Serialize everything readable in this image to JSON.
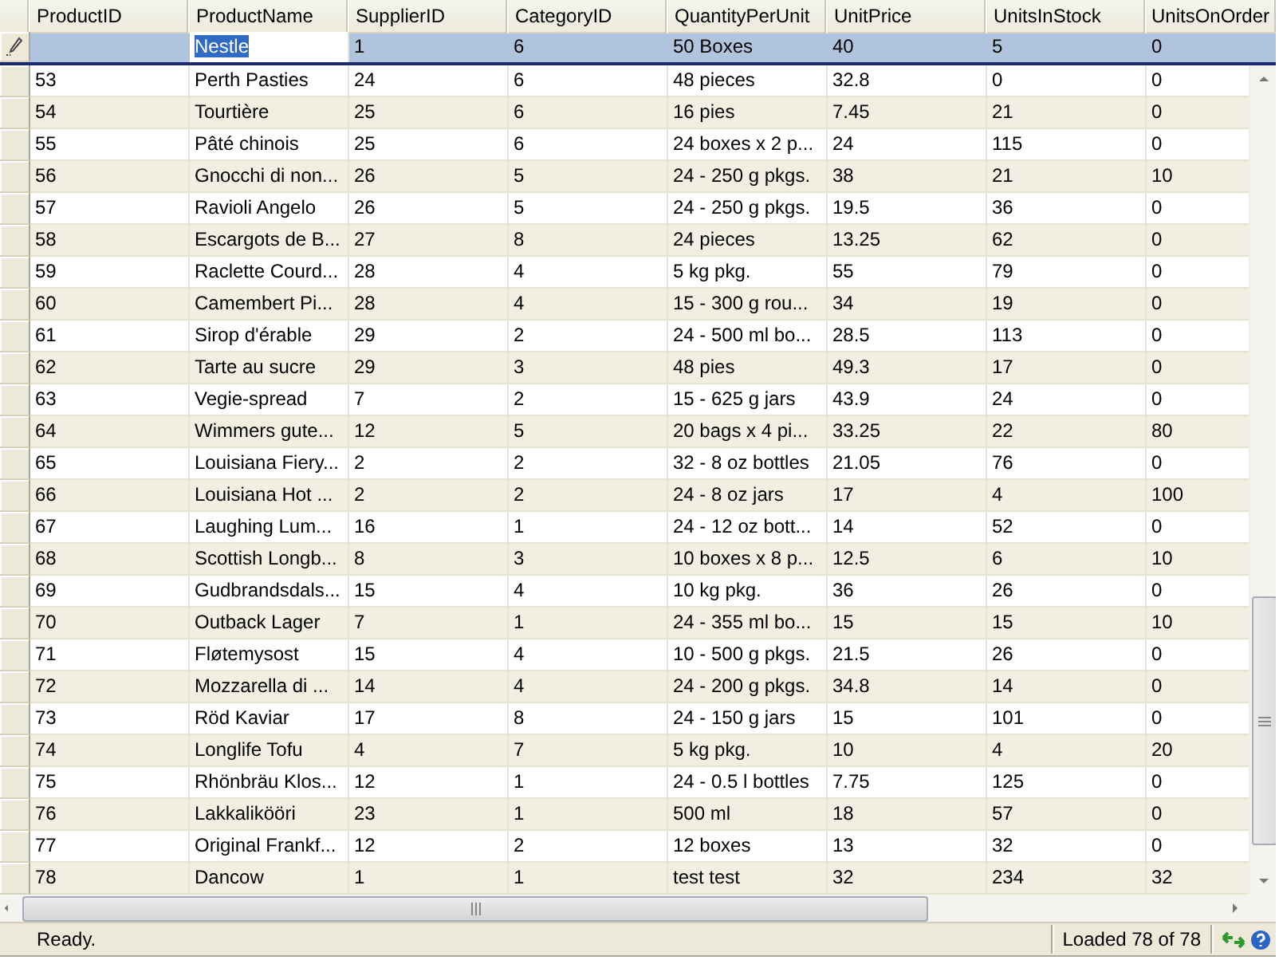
{
  "columns": [
    {
      "label": "ProductID"
    },
    {
      "label": "ProductName"
    },
    {
      "label": "SupplierID"
    },
    {
      "label": "CategoryID"
    },
    {
      "label": "QuantityPerUnit"
    },
    {
      "label": "UnitPrice"
    },
    {
      "label": "UnitsInStock"
    },
    {
      "label": "UnitsOnOrder"
    }
  ],
  "new_row": {
    "editing": true,
    "cells": [
      {
        "text": "Nestle",
        "editing": true
      },
      {
        "text": "1",
        "editing": false
      },
      {
        "text": "6",
        "editing": false
      },
      {
        "text": "50 Boxes",
        "editing": false
      },
      {
        "text": "40",
        "editing": false
      },
      {
        "text": "5",
        "editing": false
      },
      {
        "text": "0",
        "editing": false
      }
    ]
  },
  "rows": [
    {
      "selected": false,
      "cells": [
        "53",
        "Perth Pasties",
        "24",
        "6",
        "48 pieces",
        "32.8",
        "0",
        "0"
      ]
    },
    {
      "selected": false,
      "cells": [
        "54",
        "Tourtière",
        "25",
        "6",
        "16 pies",
        "7.45",
        "21",
        "0"
      ]
    },
    {
      "selected": false,
      "cells": [
        "55",
        "Pâté chinois",
        "25",
        "6",
        "24 boxes x 2 p...",
        "24",
        "115",
        "0"
      ]
    },
    {
      "selected": false,
      "cells": [
        "56",
        "Gnocchi di non...",
        "26",
        "5",
        "24 - 250 g pkgs.",
        "38",
        "21",
        "10"
      ]
    },
    {
      "selected": false,
      "cells": [
        "57",
        "Ravioli Angelo",
        "26",
        "5",
        "24 - 250 g pkgs.",
        "19.5",
        "36",
        "0"
      ]
    },
    {
      "selected": false,
      "cells": [
        "58",
        "Escargots de B...",
        "27",
        "8",
        "24 pieces",
        "13.25",
        "62",
        "0"
      ]
    },
    {
      "selected": false,
      "cells": [
        "59",
        "Raclette Courd...",
        "28",
        "4",
        "5 kg pkg.",
        "55",
        "79",
        "0"
      ]
    },
    {
      "selected": false,
      "cells": [
        "60",
        "Camembert Pi...",
        "28",
        "4",
        "15 - 300 g rou...",
        "34",
        "19",
        "0"
      ]
    },
    {
      "selected": false,
      "cells": [
        "61",
        "Sirop d'érable",
        "29",
        "2",
        "24 - 500 ml bo...",
        "28.5",
        "113",
        "0"
      ]
    },
    {
      "selected": false,
      "cells": [
        "62",
        "Tarte au sucre",
        "29",
        "3",
        "48 pies",
        "49.3",
        "17",
        "0"
      ]
    },
    {
      "selected": false,
      "cells": [
        "63",
        "Vegie-spread",
        "7",
        "2",
        "15 - 625 g jars",
        "43.9",
        "24",
        "0"
      ]
    },
    {
      "selected": false,
      "cells": [
        "64",
        "Wimmers gute...",
        "12",
        "5",
        "20 bags x 4 pi...",
        "33.25",
        "22",
        "80"
      ]
    },
    {
      "selected": false,
      "cells": [
        "65",
        "Louisiana Fiery...",
        "2",
        "2",
        "32 - 8 oz bottles",
        "21.05",
        "76",
        "0"
      ]
    },
    {
      "selected": false,
      "cells": [
        "66",
        "Louisiana Hot ...",
        "2",
        "2",
        "24 - 8 oz jars",
        "17",
        "4",
        "100"
      ]
    },
    {
      "selected": false,
      "cells": [
        "67",
        "Laughing Lum...",
        "16",
        "1",
        "24 - 12 oz bott...",
        "14",
        "52",
        "0"
      ]
    },
    {
      "selected": false,
      "cells": [
        "68",
        "Scottish Longb...",
        "8",
        "3",
        "10 boxes x 8 p...",
        "12.5",
        "6",
        "10"
      ]
    },
    {
      "selected": false,
      "cells": [
        "69",
        "Gudbrandsdals...",
        "15",
        "4",
        "10 kg pkg.",
        "36",
        "26",
        "0"
      ]
    },
    {
      "selected": false,
      "cells": [
        "70",
        "Outback Lager",
        "7",
        "1",
        "24 - 355 ml bo...",
        "15",
        "15",
        "10"
      ]
    },
    {
      "selected": false,
      "cells": [
        "71",
        "Fløtemysost",
        "15",
        "4",
        "10 - 500 g pkgs.",
        "21.5",
        "26",
        "0"
      ]
    },
    {
      "selected": false,
      "cells": [
        "72",
        "Mozzarella di ...",
        "14",
        "4",
        "24 - 200 g pkgs.",
        "34.8",
        "14",
        "0"
      ]
    },
    {
      "selected": false,
      "cells": [
        "73",
        "Röd Kaviar",
        "17",
        "8",
        "24 - 150 g jars",
        "15",
        "101",
        "0"
      ]
    },
    {
      "selected": false,
      "cells": [
        "74",
        "Longlife Tofu",
        "4",
        "7",
        "5 kg pkg.",
        "10",
        "4",
        "20"
      ]
    },
    {
      "selected": false,
      "cells": [
        "75",
        "Rhönbräu Klos...",
        "12",
        "1",
        "24 - 0.5 l bottles",
        "7.75",
        "125",
        "0"
      ]
    },
    {
      "selected": false,
      "cells": [
        "76",
        "Lakkalikööri",
        "23",
        "1",
        "500 ml",
        "18",
        "57",
        "0"
      ]
    },
    {
      "selected": false,
      "cells": [
        "77",
        "Original Frankf...",
        "12",
        "2",
        "12 boxes",
        "13",
        "32",
        "0"
      ]
    },
    {
      "selected": false,
      "cells": [
        "78",
        "Dancow",
        "1",
        "1",
        "test test",
        "32",
        "234",
        "32"
      ]
    }
  ],
  "status_bar": {
    "message": "Ready.",
    "count": "Loaded 78 of 78"
  }
}
